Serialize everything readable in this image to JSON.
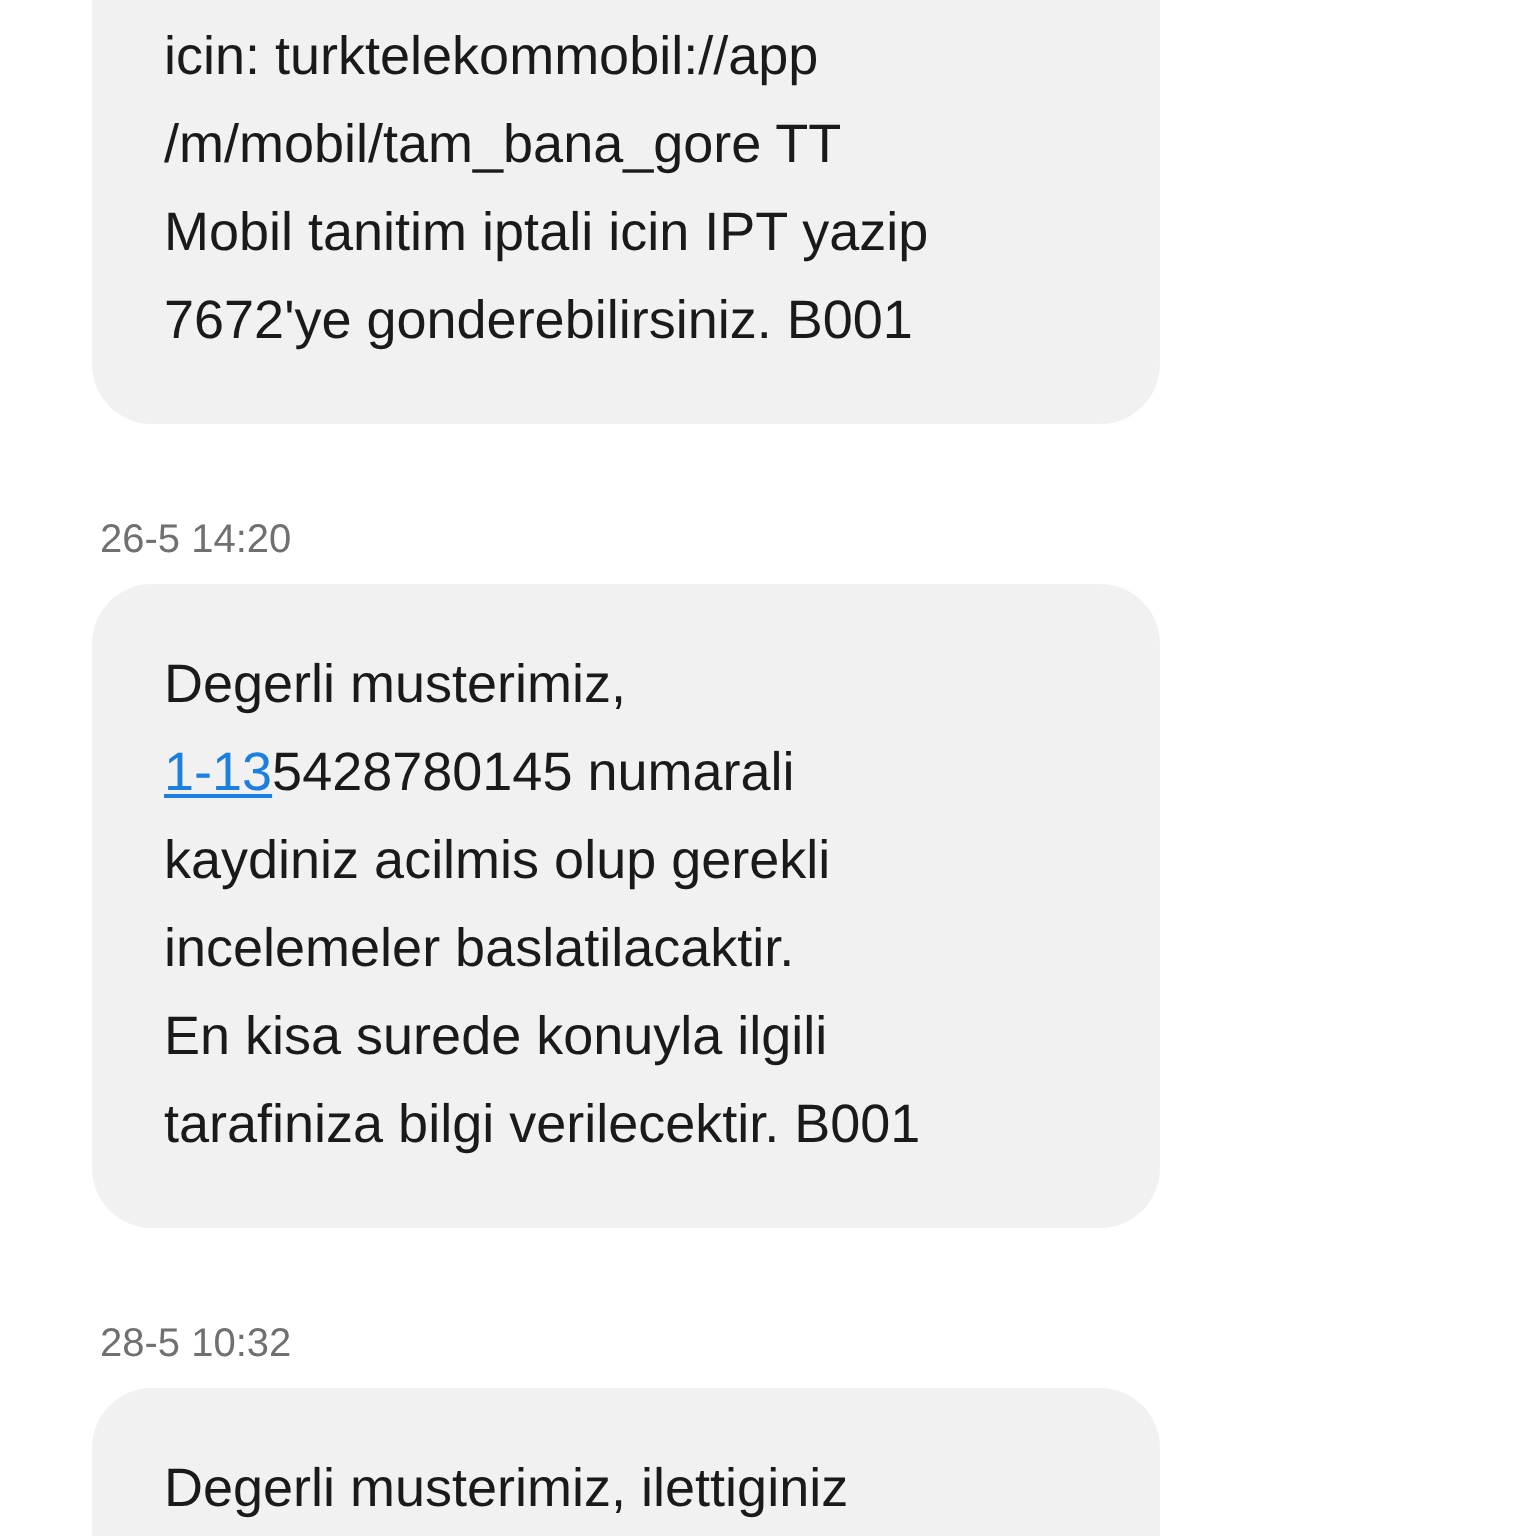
{
  "messages": [
    {
      "lines": [
        {
          "text": "icin: turktelekommobil://app"
        },
        {
          "text": "/m/mobil/tam_bana_gore TT"
        },
        {
          "text": "Mobil tanitim iptali icin IPT yazip"
        },
        {
          "text": "7672'ye gonderebilirsiniz. B001"
        }
      ]
    },
    {
      "time": "26-5 14:20",
      "lines": [
        {
          "text": "Degerli musterimiz,"
        },
        {
          "link": "1-13",
          "text": "5428780145 numarali"
        },
        {
          "text": "kaydiniz acilmis olup gerekli"
        },
        {
          "text": "incelemeler baslatilacaktir."
        },
        {
          "text": "En kisa surede konuyla ilgili"
        },
        {
          "text": "tarafiniza bilgi verilecektir. B001"
        }
      ]
    },
    {
      "time": "28-5 10:32",
      "lines": [
        {
          "text": "Degerli musterimiz, ilettiginiz"
        }
      ]
    }
  ]
}
